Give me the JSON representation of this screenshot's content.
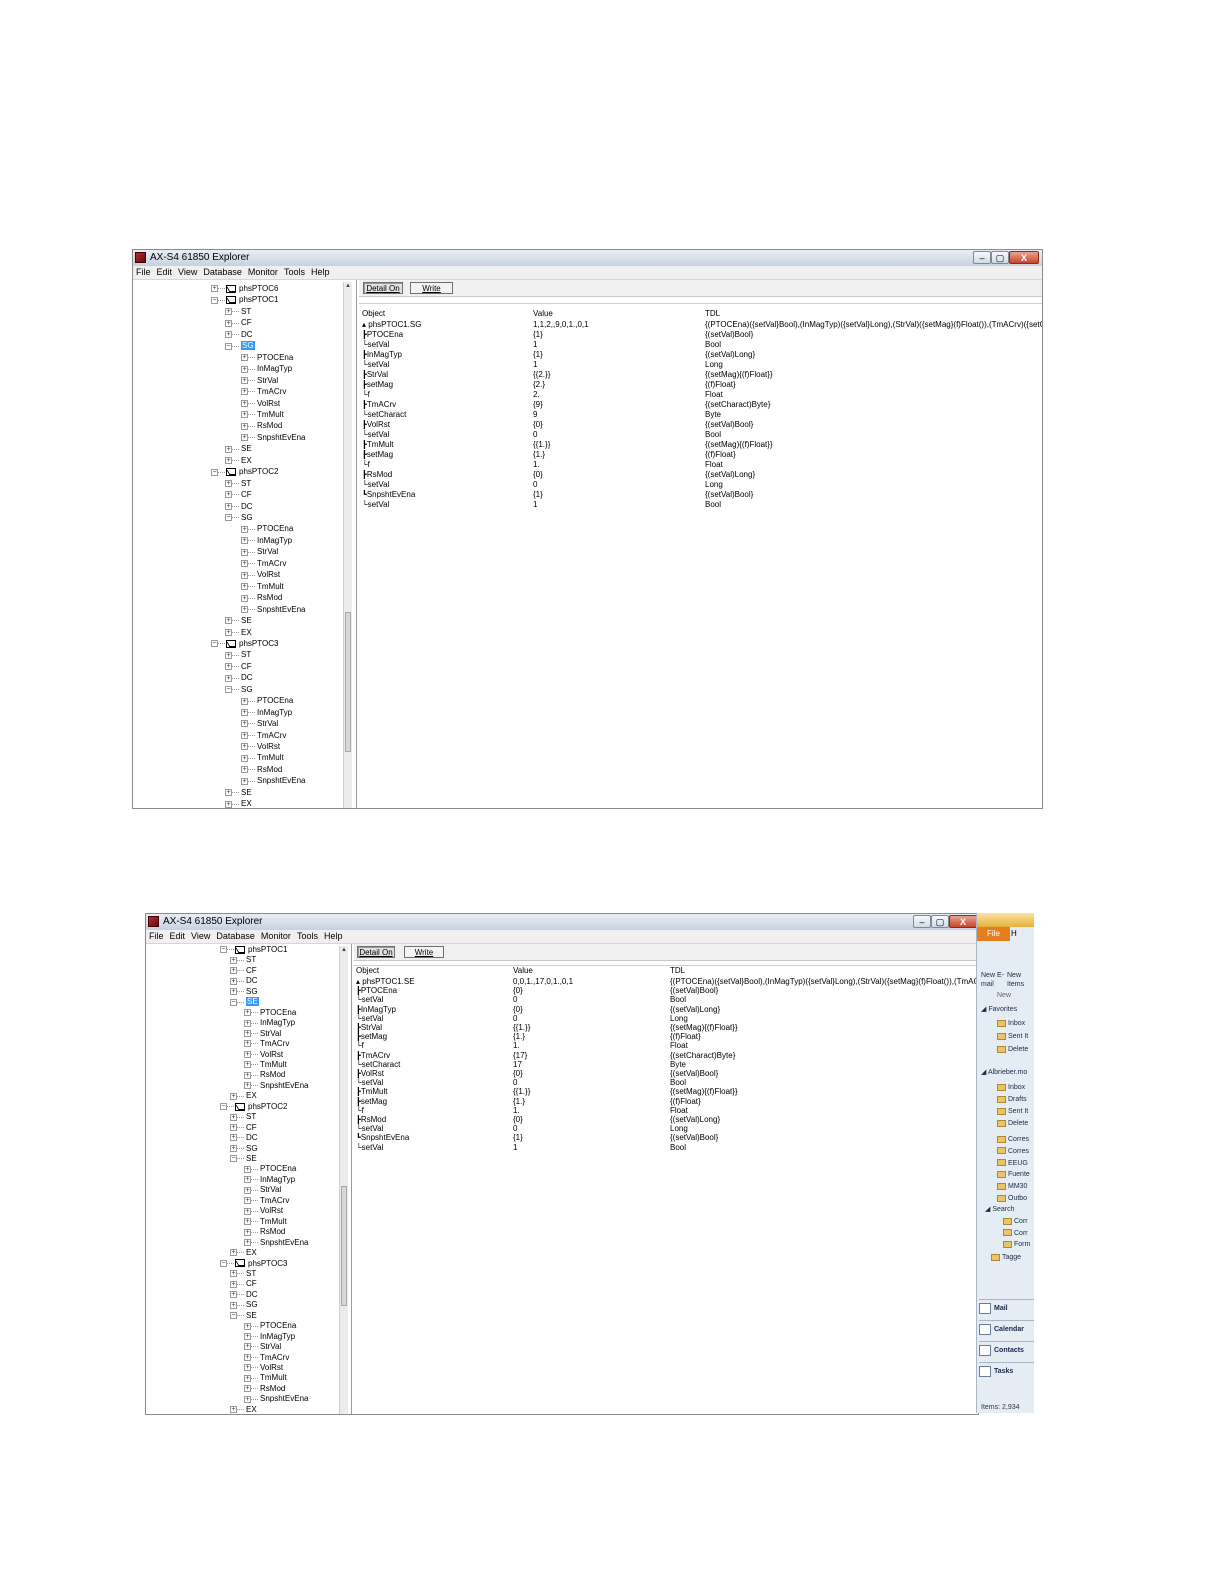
{
  "window1": {
    "title": "AX-S4 61850 Explorer",
    "controls": [
      "–",
      "▢",
      "X"
    ],
    "menu": [
      "File",
      "Edit",
      "View",
      "Database",
      "Monitor",
      "Tools",
      "Help"
    ],
    "buttons": {
      "detail": "Detail On",
      "write": "Write"
    },
    "columns": {
      "object": "Object",
      "value": "Value",
      "tdl": "TDL"
    },
    "tree": [
      {
        "t": "n",
        "pm": "+",
        "text": "phsPTOC6"
      },
      {
        "t": "n",
        "pm": "−",
        "text": "phsPTOC1"
      },
      {
        "t": "c",
        "pm": "+",
        "text": "ST"
      },
      {
        "t": "c",
        "pm": "+",
        "text": "CF"
      },
      {
        "t": "c",
        "pm": "+",
        "text": "DC"
      },
      {
        "t": "c",
        "pm": "−",
        "text": "SG",
        "sel": true
      },
      {
        "t": "g",
        "pm": "+",
        "text": "PTOCEna"
      },
      {
        "t": "g",
        "pm": "+",
        "text": "InMagTyp"
      },
      {
        "t": "g",
        "pm": "+",
        "text": "StrVal"
      },
      {
        "t": "g",
        "pm": "+",
        "text": "TmACrv"
      },
      {
        "t": "g",
        "pm": "+",
        "text": "VolRst"
      },
      {
        "t": "g",
        "pm": "+",
        "text": "TmMult"
      },
      {
        "t": "g",
        "pm": "+",
        "text": "RsMod"
      },
      {
        "t": "g",
        "pm": "+",
        "text": "SnpshtEvEna"
      },
      {
        "t": "c",
        "pm": "+",
        "text": "SE"
      },
      {
        "t": "c",
        "pm": "+",
        "text": "EX"
      },
      {
        "t": "n",
        "pm": "−",
        "text": "phsPTOC2"
      },
      {
        "t": "c",
        "pm": "+",
        "text": "ST"
      },
      {
        "t": "c",
        "pm": "+",
        "text": "CF"
      },
      {
        "t": "c",
        "pm": "+",
        "text": "DC"
      },
      {
        "t": "c",
        "pm": "−",
        "text": "SG"
      },
      {
        "t": "g",
        "pm": "+",
        "text": "PTOCEna"
      },
      {
        "t": "g",
        "pm": "+",
        "text": "InMagTyp"
      },
      {
        "t": "g",
        "pm": "+",
        "text": "StrVal"
      },
      {
        "t": "g",
        "pm": "+",
        "text": "TmACrv"
      },
      {
        "t": "g",
        "pm": "+",
        "text": "VolRst"
      },
      {
        "t": "g",
        "pm": "+",
        "text": "TmMult"
      },
      {
        "t": "g",
        "pm": "+",
        "text": "RsMod"
      },
      {
        "t": "g",
        "pm": "+",
        "text": "SnpshtEvEna"
      },
      {
        "t": "c",
        "pm": "+",
        "text": "SE"
      },
      {
        "t": "c",
        "pm": "+",
        "text": "EX"
      },
      {
        "t": "n",
        "pm": "−",
        "text": "phsPTOC3"
      },
      {
        "t": "c",
        "pm": "+",
        "text": "ST"
      },
      {
        "t": "c",
        "pm": "+",
        "text": "CF"
      },
      {
        "t": "c",
        "pm": "+",
        "text": "DC"
      },
      {
        "t": "c",
        "pm": "−",
        "text": "SG"
      },
      {
        "t": "g",
        "pm": "+",
        "text": "PTOCEna"
      },
      {
        "t": "g",
        "pm": "+",
        "text": "InMagTyp"
      },
      {
        "t": "g",
        "pm": "+",
        "text": "StrVal"
      },
      {
        "t": "g",
        "pm": "+",
        "text": "TmACrv"
      },
      {
        "t": "g",
        "pm": "+",
        "text": "VolRst"
      },
      {
        "t": "g",
        "pm": "+",
        "text": "TmMult"
      },
      {
        "t": "g",
        "pm": "+",
        "text": "RsMod"
      },
      {
        "t": "g",
        "pm": "+",
        "text": "SnpshtEvEna"
      },
      {
        "t": "c",
        "pm": "+",
        "text": "SE"
      },
      {
        "t": "c",
        "pm": "+",
        "text": "EX"
      }
    ],
    "rows": [
      {
        "obj": "▴  phsPTOC1.SG",
        "val": "1,1,2,,9,0,1.,0,1",
        "tdl": "{(PTOCEna)({setVal}Bool),(InMagTyp)({setVal}Long),(StrVal)({setMag}(f)Float()),(TmACrv)({setCharac"
      },
      {
        "obj": "  ┣PTOCEna",
        "val": "{1}",
        "tdl": "{(setVal)Bool}"
      },
      {
        "obj": "     └setVal",
        "val": "1",
        "tdl": "Bool"
      },
      {
        "obj": "  ┣InMagTyp",
        "val": "{1}",
        "tdl": "{(setVal)Long}"
      },
      {
        "obj": "     └setVal",
        "val": "1",
        "tdl": "Long"
      },
      {
        "obj": "  ┣StrVal",
        "val": "{{2.}}",
        "tdl": "{(setMag){(f)Float}}"
      },
      {
        "obj": "     ┣setMag",
        "val": "{2.}",
        "tdl": "{(f)Float}"
      },
      {
        "obj": "          └f",
        "val": "2.",
        "tdl": "Float"
      },
      {
        "obj": "  ┣TmACrv",
        "val": "{9}",
        "tdl": "{(setCharact)Byte}"
      },
      {
        "obj": "     └setCharact",
        "val": "9",
        "tdl": "Byte"
      },
      {
        "obj": "  ┣VolRst",
        "val": "{0}",
        "tdl": "{(setVal)Bool}"
      },
      {
        "obj": "     └setVal",
        "val": "0",
        "tdl": "Bool"
      },
      {
        "obj": "  ┣TmMult",
        "val": "{{1.}}",
        "tdl": "{(setMag){(f)Float}}"
      },
      {
        "obj": "     ┣setMag",
        "val": "{1.}",
        "tdl": "{(f)Float}"
      },
      {
        "obj": "          └f",
        "val": "1.",
        "tdl": "Float"
      },
      {
        "obj": "  ┣RsMod",
        "val": "{0}",
        "tdl": "{(setVal)Long}"
      },
      {
        "obj": "     └setVal",
        "val": "0",
        "tdl": "Long"
      },
      {
        "obj": "  ┗SnpshtEvEna",
        "val": "{1}",
        "tdl": "{(setVal)Bool}"
      },
      {
        "obj": "     └setVal",
        "val": "1",
        "tdl": "Bool"
      }
    ]
  },
  "window2": {
    "title": "AX-S4 61850 Explorer",
    "controls": [
      "–",
      "▢",
      "X"
    ],
    "menu": [
      "File",
      "Edit",
      "View",
      "Database",
      "Monitor",
      "Tools",
      "Help"
    ],
    "buttons": {
      "detail": "Detail On",
      "write": "Write"
    },
    "columns": {
      "object": "Object",
      "value": "Value",
      "tdl": "TDL"
    },
    "tree": [
      {
        "t": "n",
        "pm": "−",
        "text": "phsPTOC1"
      },
      {
        "t": "c",
        "pm": "+",
        "text": "ST"
      },
      {
        "t": "c",
        "pm": "+",
        "text": "CF"
      },
      {
        "t": "c",
        "pm": "+",
        "text": "DC"
      },
      {
        "t": "c",
        "pm": "+",
        "text": "SG"
      },
      {
        "t": "c",
        "pm": "−",
        "text": "SE",
        "sel": true
      },
      {
        "t": "g",
        "pm": "+",
        "text": "PTOCEna"
      },
      {
        "t": "g",
        "pm": "+",
        "text": "InMagTyp"
      },
      {
        "t": "g",
        "pm": "+",
        "text": "StrVal"
      },
      {
        "t": "g",
        "pm": "+",
        "text": "TmACrv"
      },
      {
        "t": "g",
        "pm": "+",
        "text": "VolRst"
      },
      {
        "t": "g",
        "pm": "+",
        "text": "TmMult"
      },
      {
        "t": "g",
        "pm": "+",
        "text": "RsMod"
      },
      {
        "t": "g",
        "pm": "+",
        "text": "SnpshtEvEna"
      },
      {
        "t": "c",
        "pm": "+",
        "text": "EX"
      },
      {
        "t": "n",
        "pm": "−",
        "text": "phsPTOC2"
      },
      {
        "t": "c",
        "pm": "+",
        "text": "ST"
      },
      {
        "t": "c",
        "pm": "+",
        "text": "CF"
      },
      {
        "t": "c",
        "pm": "+",
        "text": "DC"
      },
      {
        "t": "c",
        "pm": "+",
        "text": "SG"
      },
      {
        "t": "c",
        "pm": "−",
        "text": "SE"
      },
      {
        "t": "g",
        "pm": "+",
        "text": "PTOCEna"
      },
      {
        "t": "g",
        "pm": "+",
        "text": "InMagTyp"
      },
      {
        "t": "g",
        "pm": "+",
        "text": "StrVal"
      },
      {
        "t": "g",
        "pm": "+",
        "text": "TmACrv"
      },
      {
        "t": "g",
        "pm": "+",
        "text": "VolRst"
      },
      {
        "t": "g",
        "pm": "+",
        "text": "TmMult"
      },
      {
        "t": "g",
        "pm": "+",
        "text": "RsMod"
      },
      {
        "t": "g",
        "pm": "+",
        "text": "SnpshtEvEna"
      },
      {
        "t": "c",
        "pm": "+",
        "text": "EX"
      },
      {
        "t": "n",
        "pm": "−",
        "text": "phsPTOC3"
      },
      {
        "t": "c",
        "pm": "+",
        "text": "ST"
      },
      {
        "t": "c",
        "pm": "+",
        "text": "CF"
      },
      {
        "t": "c",
        "pm": "+",
        "text": "DC"
      },
      {
        "t": "c",
        "pm": "+",
        "text": "SG"
      },
      {
        "t": "c",
        "pm": "−",
        "text": "SE"
      },
      {
        "t": "g",
        "pm": "+",
        "text": "PTOCEna"
      },
      {
        "t": "g",
        "pm": "+",
        "text": "InMagTyp"
      },
      {
        "t": "g",
        "pm": "+",
        "text": "StrVal"
      },
      {
        "t": "g",
        "pm": "+",
        "text": "TmACrv"
      },
      {
        "t": "g",
        "pm": "+",
        "text": "VolRst"
      },
      {
        "t": "g",
        "pm": "+",
        "text": "TmMult"
      },
      {
        "t": "g",
        "pm": "+",
        "text": "RsMod"
      },
      {
        "t": "g",
        "pm": "+",
        "text": "SnpshtEvEna"
      },
      {
        "t": "c",
        "pm": "+",
        "text": "EX"
      }
    ],
    "rows": [
      {
        "obj": "▴  phsPTOC1.SE",
        "val": "0,0,1.,17,0,1.,0,1",
        "tdl": "{(PTOCEna)({setVal}Bool),(InMagTyp)({setVal}Long),(StrVal)({setMag}(f)Float()),(TmACrv)({setCharac"
      },
      {
        "obj": "  ┣PTOCEna",
        "val": "{0}",
        "tdl": "{(setVal)Bool}"
      },
      {
        "obj": "     └setVal",
        "val": "0",
        "tdl": "Bool"
      },
      {
        "obj": "  ┣InMagTyp",
        "val": "{0}",
        "tdl": "{(setVal)Long}"
      },
      {
        "obj": "     └setVal",
        "val": "0",
        "tdl": "Long"
      },
      {
        "obj": "  ┣StrVal",
        "val": "{{1.}}",
        "tdl": "{(setMag){(f)Float}}"
      },
      {
        "obj": "     ┣setMag",
        "val": "{1.}",
        "tdl": "{(f)Float}"
      },
      {
        "obj": "          └f",
        "val": "1.",
        "tdl": "Float"
      },
      {
        "obj": "  ┣TmACrv",
        "val": "{17}",
        "tdl": "{(setCharact)Byte}"
      },
      {
        "obj": "     └setCharact",
        "val": "17",
        "tdl": "Byte"
      },
      {
        "obj": "  ┣VolRst",
        "val": "{0}",
        "tdl": "{(setVal)Bool}"
      },
      {
        "obj": "     └setVal",
        "val": "0",
        "tdl": "Bool"
      },
      {
        "obj": "  ┣TmMult",
        "val": "{{1.}}",
        "tdl": "{(setMag){(f)Float}}"
      },
      {
        "obj": "     ┣setMag",
        "val": "{1.}",
        "tdl": "{(f)Float}"
      },
      {
        "obj": "          └f",
        "val": "1.",
        "tdl": "Float"
      },
      {
        "obj": "  ┣RsMod",
        "val": "{0}",
        "tdl": "{(setVal)Long}"
      },
      {
        "obj": "     └setVal",
        "val": "0",
        "tdl": "Long"
      },
      {
        "obj": "  ┗SnpshtEvEna",
        "val": "{1}",
        "tdl": "{(setVal)Bool}"
      },
      {
        "obj": "     └setVal",
        "val": "1",
        "tdl": "Bool"
      }
    ]
  },
  "outlook": {
    "file_tab": "File",
    "home_tab": "H",
    "new_email": "New E-mail",
    "new_items": "New Items",
    "new_group": "New",
    "favorites": "◢ Favorites",
    "fav_items": [
      "Inbox",
      "Sent It",
      "Delete"
    ],
    "account": "◢ Albrieber.mo",
    "account_items": [
      "Inbox",
      "Drafts",
      "Sent It",
      "Delete"
    ],
    "other_folders": [
      "Corres",
      "Corres",
      "EEUG",
      "Fuente",
      "MM30",
      "Outbo"
    ],
    "search": "◢ Search",
    "search_items": [
      "Corr",
      "Corr",
      "Form"
    ],
    "tagged": "Tagge",
    "nav": [
      "Mail",
      "Calendar",
      "Contacts",
      "Tasks"
    ],
    "status": "Items: 2,934"
  },
  "colors": {
    "selection": "#3399ff",
    "outlook_file_tab": "#e37f1e"
  }
}
